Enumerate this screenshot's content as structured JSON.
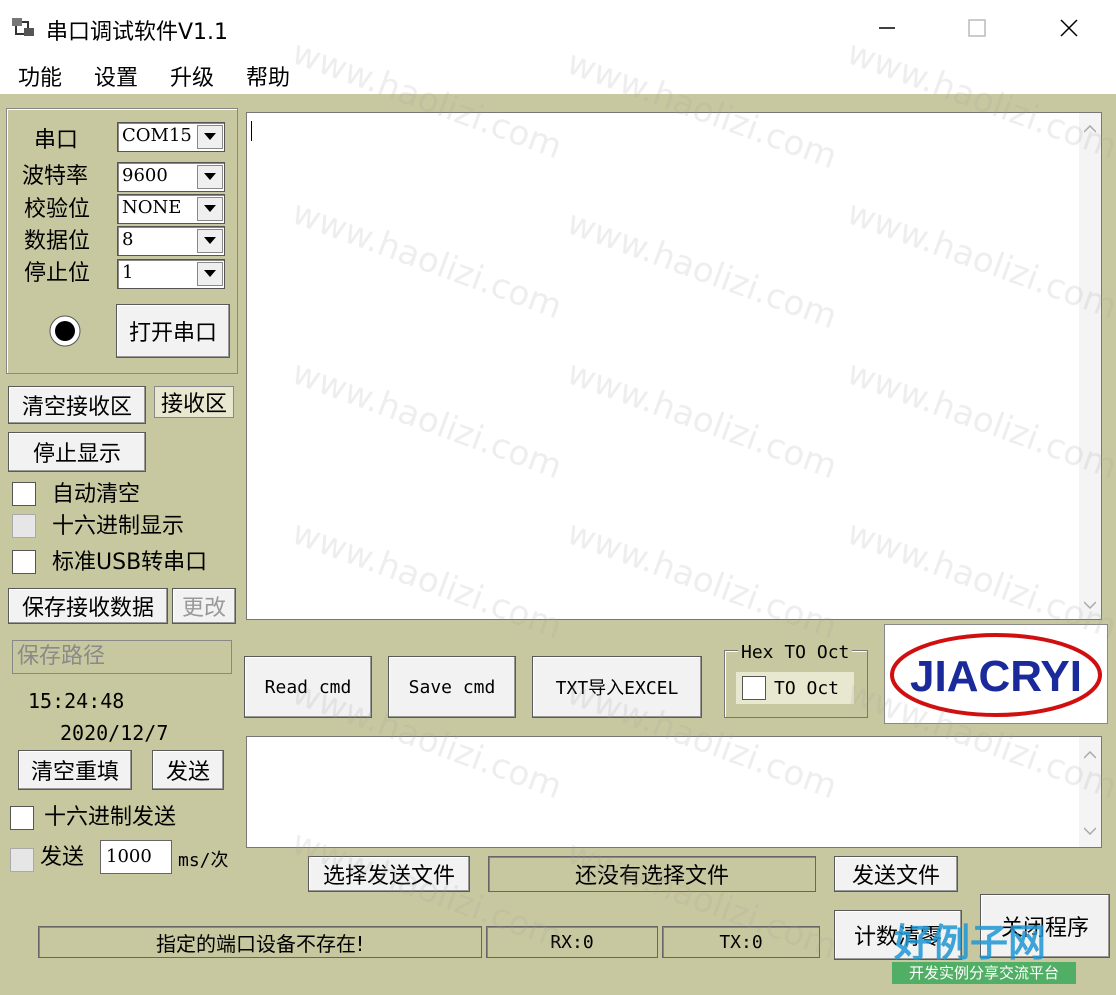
{
  "window": {
    "title": "串口调试软件V1.1"
  },
  "menu": [
    "功能",
    "设置",
    "升级",
    "帮助"
  ],
  "serial": {
    "labels": {
      "port": "串口",
      "baud": "波特率",
      "parity": "校验位",
      "databits": "数据位",
      "stopbits": "停止位"
    },
    "values": {
      "port": "COM15",
      "baud": "9600",
      "parity": "NONE",
      "databits": "8",
      "stopbits": "1"
    },
    "open_button": "打开串口"
  },
  "receive": {
    "clear_button": "清空接收区",
    "area_label": "接收区",
    "stop_display_button": "停止显示",
    "auto_clear": "自动清空",
    "hex_display": "十六进制显示",
    "usb_serial": "标准USB转串口",
    "save_button": "保存接收数据",
    "change_button": "更改",
    "save_path": "保存路径"
  },
  "clock": {
    "time": "15:24:48",
    "date": "2020/12/7"
  },
  "send": {
    "clear_button": "清空重填",
    "send_button": "发送",
    "hex_send": "十六进制发送",
    "auto_send": "发送",
    "interval_value": "1000",
    "interval_unit": "ms/次"
  },
  "middle": {
    "read_cmd": "Read cmd",
    "save_cmd": "Save cmd",
    "txt_excel": "TXT导入EXCEL",
    "hex_group_title": "Hex TO Oct",
    "to_oct": "TO Oct"
  },
  "logo": {
    "text": "JIACRYI",
    "color": "#1a2a9a",
    "ring_color": "#d01010"
  },
  "file": {
    "choose_button": "选择发送文件",
    "status": "还没有选择文件",
    "send_file_button": "发送文件"
  },
  "status_bar": {
    "message": "指定的端口设备不存在!",
    "rx": "RX:0",
    "tx": "TX:0"
  },
  "bottom_buttons": {
    "count_clear": "计数清零",
    "close_app": "关闭程序"
  },
  "watermark": {
    "text": "www.haolizi.com",
    "site": "好例子网",
    "slogan": "开发实例分享交流平台"
  }
}
